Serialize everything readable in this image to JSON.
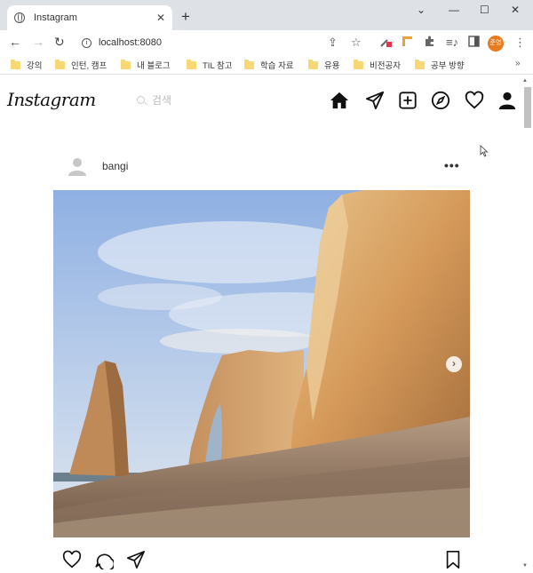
{
  "browser": {
    "tab_title": "Instagram",
    "tab_close": "✕",
    "new_tab": "+",
    "window_controls": [
      "⌄",
      "—",
      "☐",
      "✕"
    ],
    "url": "localhost:8080",
    "profile_initials": "준영"
  },
  "bookmarks": [
    "강의",
    "인턴, 캠프",
    "내 블로그",
    "TIL 참고",
    "학습 자료",
    "유용",
    "비전공자",
    "공부 방향"
  ],
  "bookmarks_more": "»",
  "header": {
    "logo": "Instagram",
    "search_placeholder": "검색",
    "nav_icons": [
      "home-icon",
      "direct-icon",
      "new-post-icon",
      "explore-icon",
      "activity-icon",
      "profile-icon"
    ]
  },
  "post": {
    "username": "bangi",
    "more_label": "•••",
    "next_label": "›",
    "action_icons": [
      "like-icon",
      "comment-icon",
      "share-icon",
      "save-icon"
    ]
  }
}
